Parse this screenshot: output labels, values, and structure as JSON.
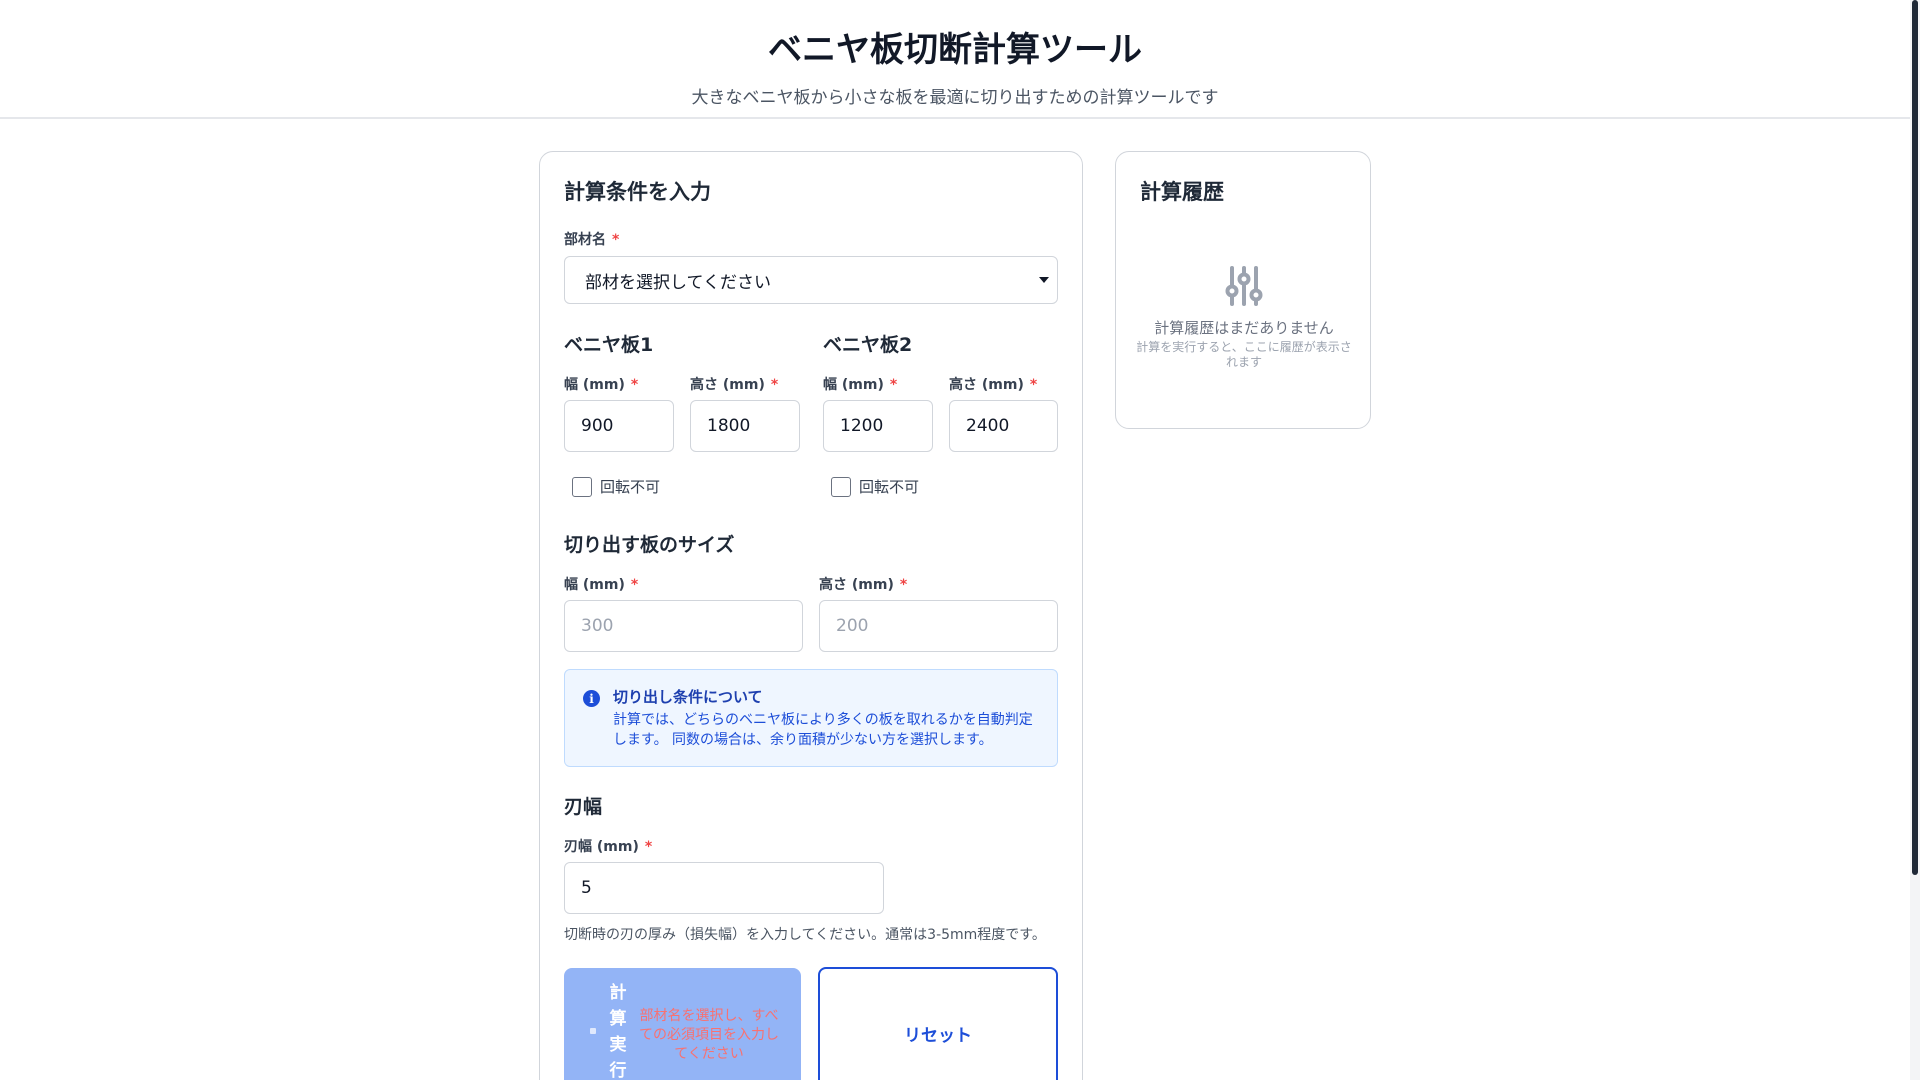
{
  "header": {
    "title": "ベニヤ板切断計算ツール",
    "subtitle": "大きなベニヤ板から小さな板を最適に切り出すための計算ツールです"
  },
  "form": {
    "title": "計算条件を入力",
    "required_mark": "*",
    "part": {
      "label": "部材名",
      "selected": "部材を選択してください"
    },
    "plywood1": {
      "title": "ベニヤ板1",
      "width_label": "幅 (mm)",
      "height_label": "高さ (mm)",
      "width_value": "900",
      "height_value": "1800",
      "no_rotate_label": "回転不可"
    },
    "plywood2": {
      "title": "ベニヤ板2",
      "width_label": "幅 (mm)",
      "height_label": "高さ (mm)",
      "width_value": "1200",
      "height_value": "2400",
      "no_rotate_label": "回転不可"
    },
    "cut_size": {
      "title": "切り出す板のサイズ",
      "width_label": "幅 (mm)",
      "height_label": "高さ (mm)",
      "width_placeholder": "300",
      "height_placeholder": "200"
    },
    "info": {
      "icon": "i",
      "title": "切り出し条件について",
      "text": "計算では、どちらのベニヤ板により多くの板を取れるかを自動判定します。 同数の場合は、余り面積が少ない方を選択します。"
    },
    "blade": {
      "title": "刃幅",
      "label": "刃幅 (mm)",
      "value": "5",
      "help": "切断時の刃の厚み（損失幅）を入力してください。通常は3-5mm程度です。"
    },
    "buttons": {
      "calculate": "計算実行",
      "calculate_warning": "部材名を選択し、すべての必須項目を入力してください",
      "reset": "リセット"
    }
  },
  "history": {
    "title": "計算履歴",
    "icon": "sliders-icon",
    "empty": "計算履歴はまだありません",
    "hint": "計算を実行すると、ここに履歴が表示されます"
  },
  "colors": {
    "accent": "#1d4ed8",
    "disabled_button": "#93b4f6",
    "required": "#ef4444",
    "info_bg": "#eff6ff"
  }
}
